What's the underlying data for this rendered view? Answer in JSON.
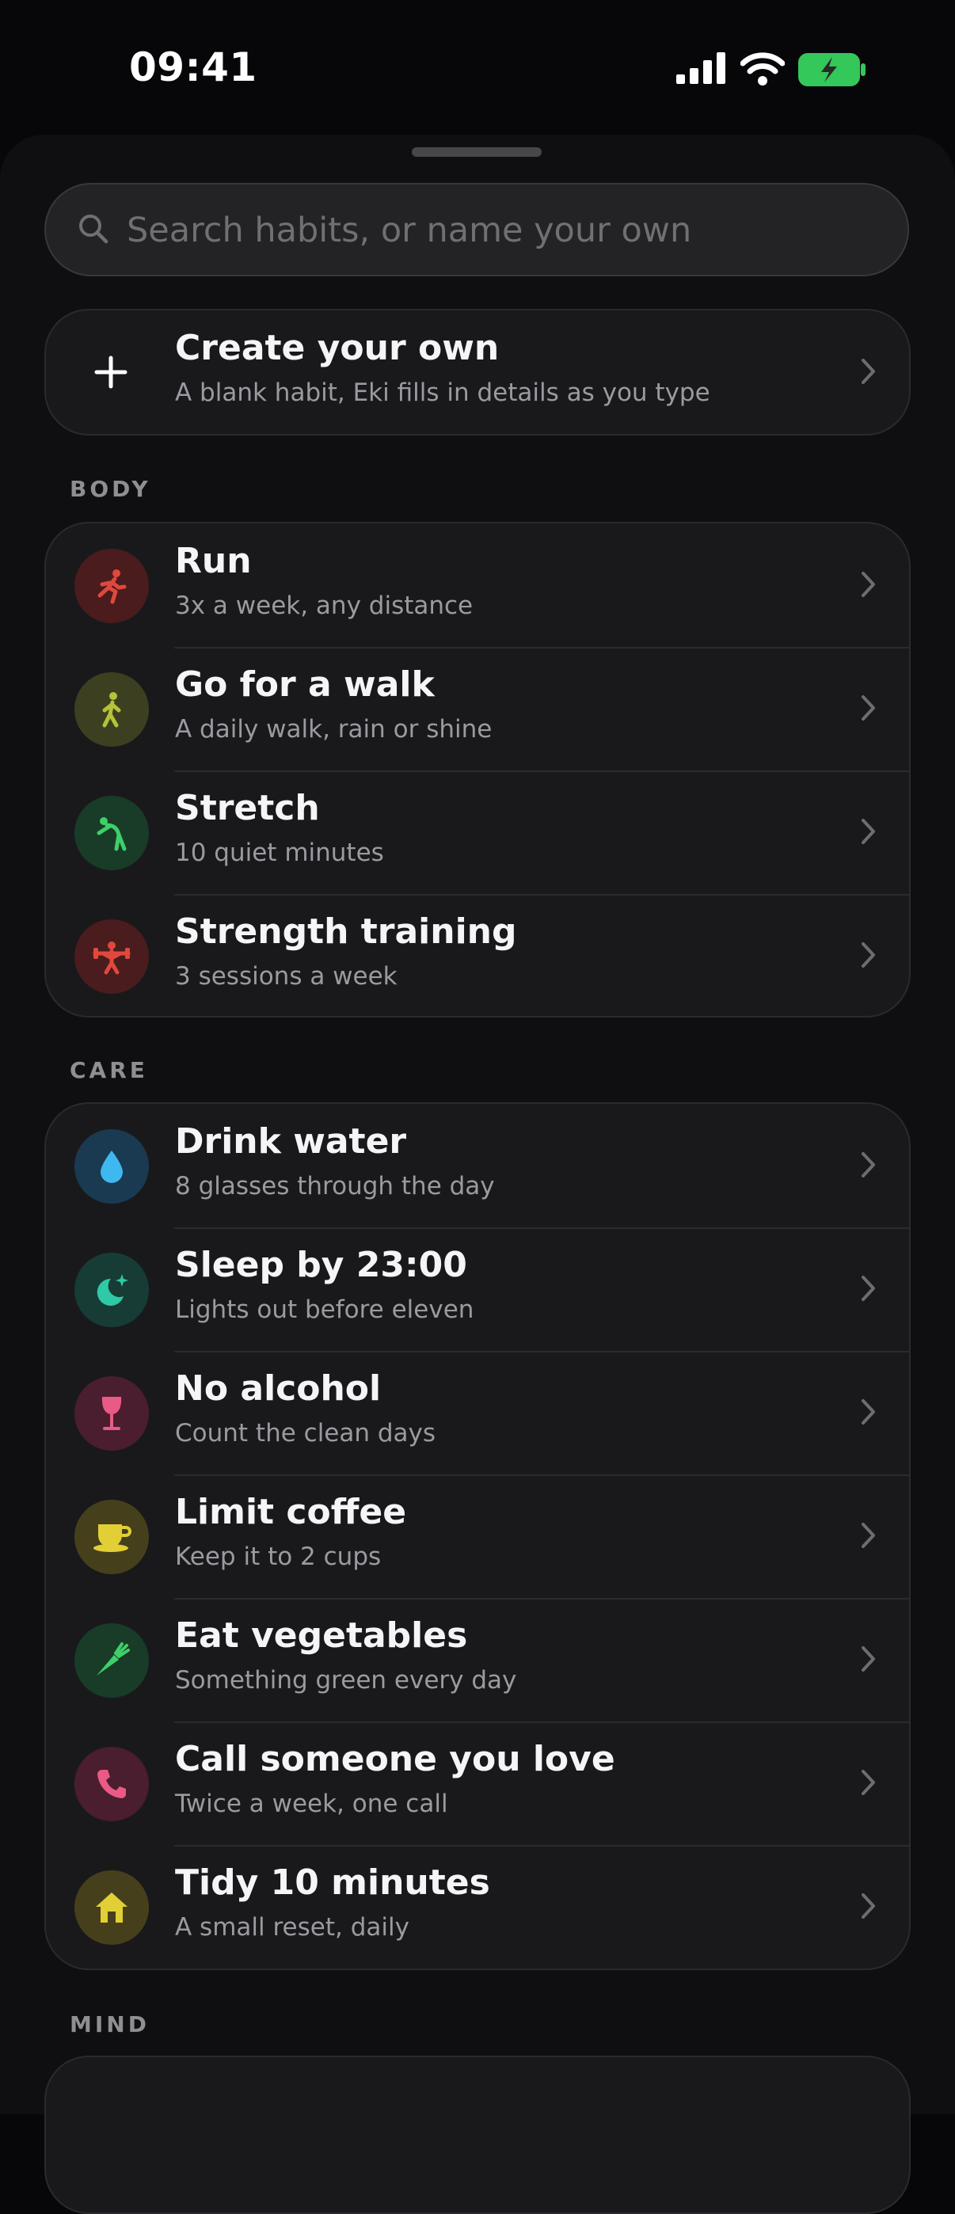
{
  "status_bar": {
    "time": "09:41"
  },
  "search": {
    "placeholder": "Search habits, or name your own"
  },
  "create": {
    "title": "Create your own",
    "subtitle": "A blank habit, Eki fills in details as you type"
  },
  "sections": [
    {
      "header": "BODY",
      "items": [
        {
          "title": "Run",
          "subtitle": "3x a week, any distance",
          "icon": "run-icon",
          "color": "#e0483e",
          "bg": "#4a1c1d"
        },
        {
          "title": "Go for a walk",
          "subtitle": "A daily walk, rain or shine",
          "icon": "walk-icon",
          "color": "#b5c23a",
          "bg": "#3c4020"
        },
        {
          "title": "Stretch",
          "subtitle": "10 quiet minutes",
          "icon": "stretch-icon",
          "color": "#3ecf6a",
          "bg": "#183c27"
        },
        {
          "title": "Strength training",
          "subtitle": "3 sessions a week",
          "icon": "strength-icon",
          "color": "#e0483e",
          "bg": "#4a1c1d"
        }
      ]
    },
    {
      "header": "CARE",
      "items": [
        {
          "title": "Drink water",
          "subtitle": "8 glasses through the day",
          "icon": "water-drop-icon",
          "color": "#3fb8f0",
          "bg": "#1a3a52"
        },
        {
          "title": "Sleep by 23:00",
          "subtitle": "Lights out before eleven",
          "icon": "moon-icon",
          "color": "#2ec9a5",
          "bg": "#173c36"
        },
        {
          "title": "No alcohol",
          "subtitle": "Count the clean days",
          "icon": "wine-glass-icon",
          "color": "#ea5a86",
          "bg": "#4a1d2f"
        },
        {
          "title": "Limit coffee",
          "subtitle": "Keep it to 2 cups",
          "icon": "coffee-cup-icon",
          "color": "#e2cf36",
          "bg": "#45401b"
        },
        {
          "title": "Eat vegetables",
          "subtitle": "Something green every day",
          "icon": "carrot-icon",
          "color": "#3ecf6a",
          "bg": "#183c27"
        },
        {
          "title": "Call someone you love",
          "subtitle": "Twice a week, one call",
          "icon": "phone-icon",
          "color": "#ea5a86",
          "bg": "#4a1d2f"
        },
        {
          "title": "Tidy 10 minutes",
          "subtitle": "A small reset, daily",
          "icon": "house-icon",
          "color": "#e2cf36",
          "bg": "#45401b"
        }
      ]
    },
    {
      "header": "MIND",
      "items": []
    }
  ]
}
